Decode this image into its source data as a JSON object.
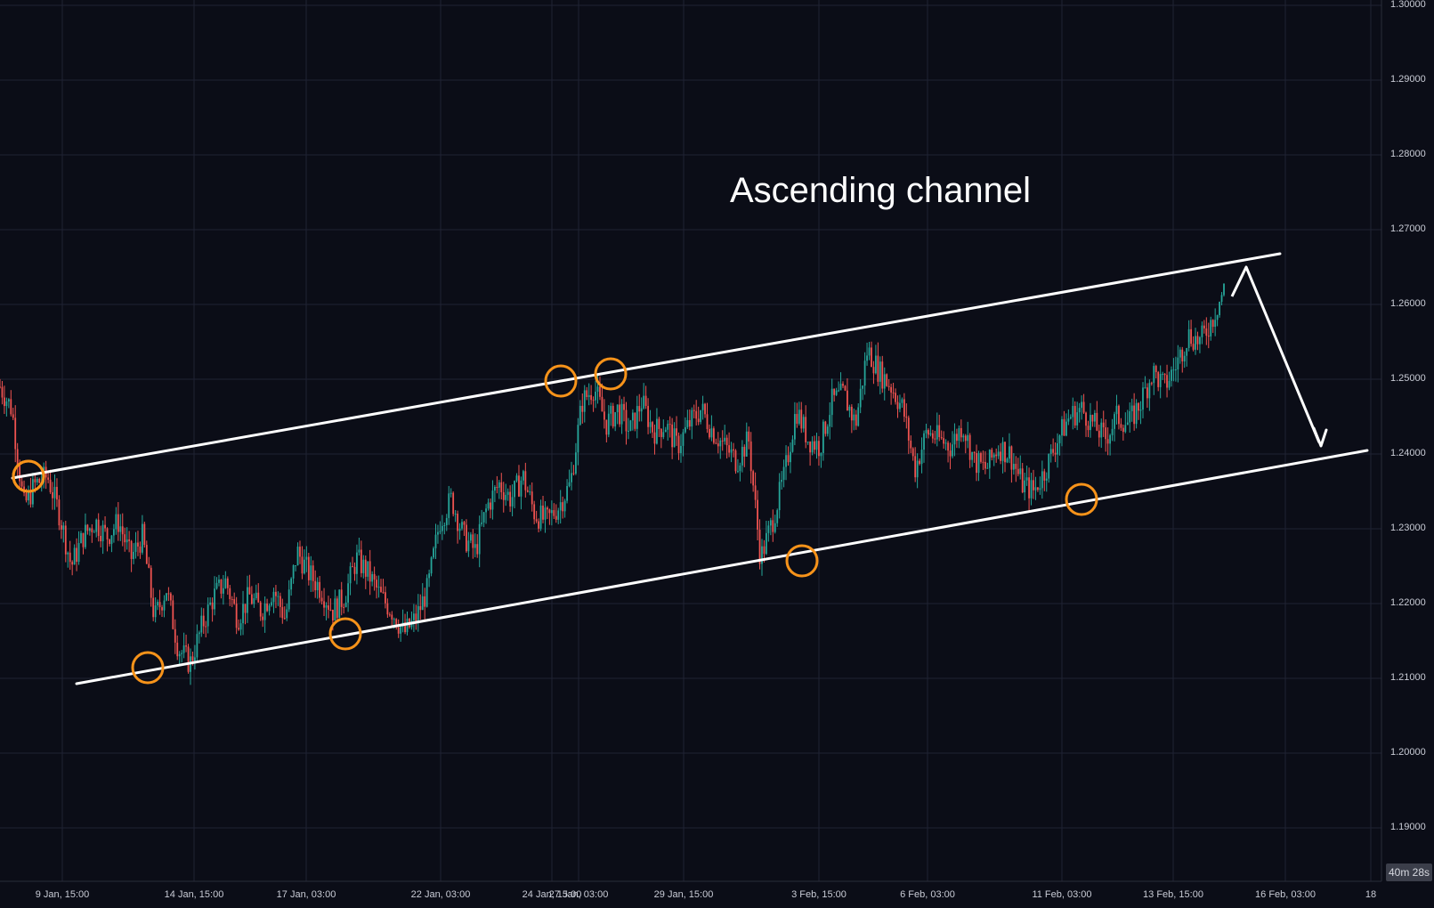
{
  "chart_data": {
    "type": "candlestick",
    "annotation": "Ascending channel",
    "y_axis": {
      "ticks": [
        "1.30000",
        "1.29000",
        "1.28000",
        "1.27000",
        "1.26000",
        "1.25000",
        "1.24000",
        "1.23000",
        "1.22000",
        "1.21000",
        "1.20000",
        "1.19000"
      ],
      "range": [
        1.186,
        1.3
      ]
    },
    "x_axis": {
      "ticks": [
        "9 Jan, 15:00",
        "14 Jan, 15:00",
        "17 Jan, 03:00",
        "22 Jan, 03:00",
        "24 Jan, 15:00",
        "27 Jan, 03:00",
        "29 Jan, 15:00",
        "3 Feb, 15:00",
        "6 Feb, 03:00",
        "11 Feb, 03:00",
        "13 Feb, 15:00",
        "16 Feb, 03:00",
        "18"
      ]
    },
    "price_path": [
      1.249,
      1.246,
      1.233,
      1.236,
      1.237,
      1.232,
      1.225,
      1.229,
      1.231,
      1.229,
      1.231,
      1.226,
      1.229,
      1.218,
      1.222,
      1.214,
      1.212,
      1.217,
      1.221,
      1.223,
      1.218,
      1.221,
      1.219,
      1.222,
      1.218,
      1.227,
      1.224,
      1.222,
      1.219,
      1.221,
      1.226,
      1.224,
      1.221,
      1.219,
      1.216,
      1.218,
      1.222,
      1.231,
      1.234,
      1.229,
      1.227,
      1.233,
      1.236,
      1.234,
      1.237,
      1.232,
      1.231,
      1.233,
      1.236,
      1.247,
      1.249,
      1.244,
      1.246,
      1.243,
      1.247,
      1.243,
      1.244,
      1.241,
      1.244,
      1.246,
      1.243,
      1.241,
      1.239,
      1.242,
      1.226,
      1.231,
      1.237,
      1.246,
      1.242,
      1.241,
      1.247,
      1.248,
      1.244,
      1.254,
      1.251,
      1.249,
      1.246,
      1.238,
      1.243,
      1.242,
      1.241,
      1.244,
      1.239,
      1.238,
      1.241,
      1.24,
      1.236,
      1.235,
      1.238,
      1.242,
      1.245,
      1.246,
      1.244,
      1.242,
      1.245,
      1.244,
      1.247,
      1.251,
      1.249,
      1.252,
      1.256,
      1.255,
      1.258,
      1.262
    ],
    "channel": {
      "upper": [
        [
          1.237,
          0
        ],
        [
          1.266,
          1
        ]
      ],
      "lower": [
        [
          1.209,
          0
        ],
        [
          1.24,
          1
        ]
      ]
    },
    "touch_points": 8,
    "projection": "down to lower channel line",
    "colors": {
      "background": "#0b0d17",
      "up": "#26a69a",
      "down": "#ef5350",
      "channel": "#ffffff",
      "touch": "#f7931a",
      "grid": "#1f2233"
    }
  },
  "countdown": "40m 28s"
}
